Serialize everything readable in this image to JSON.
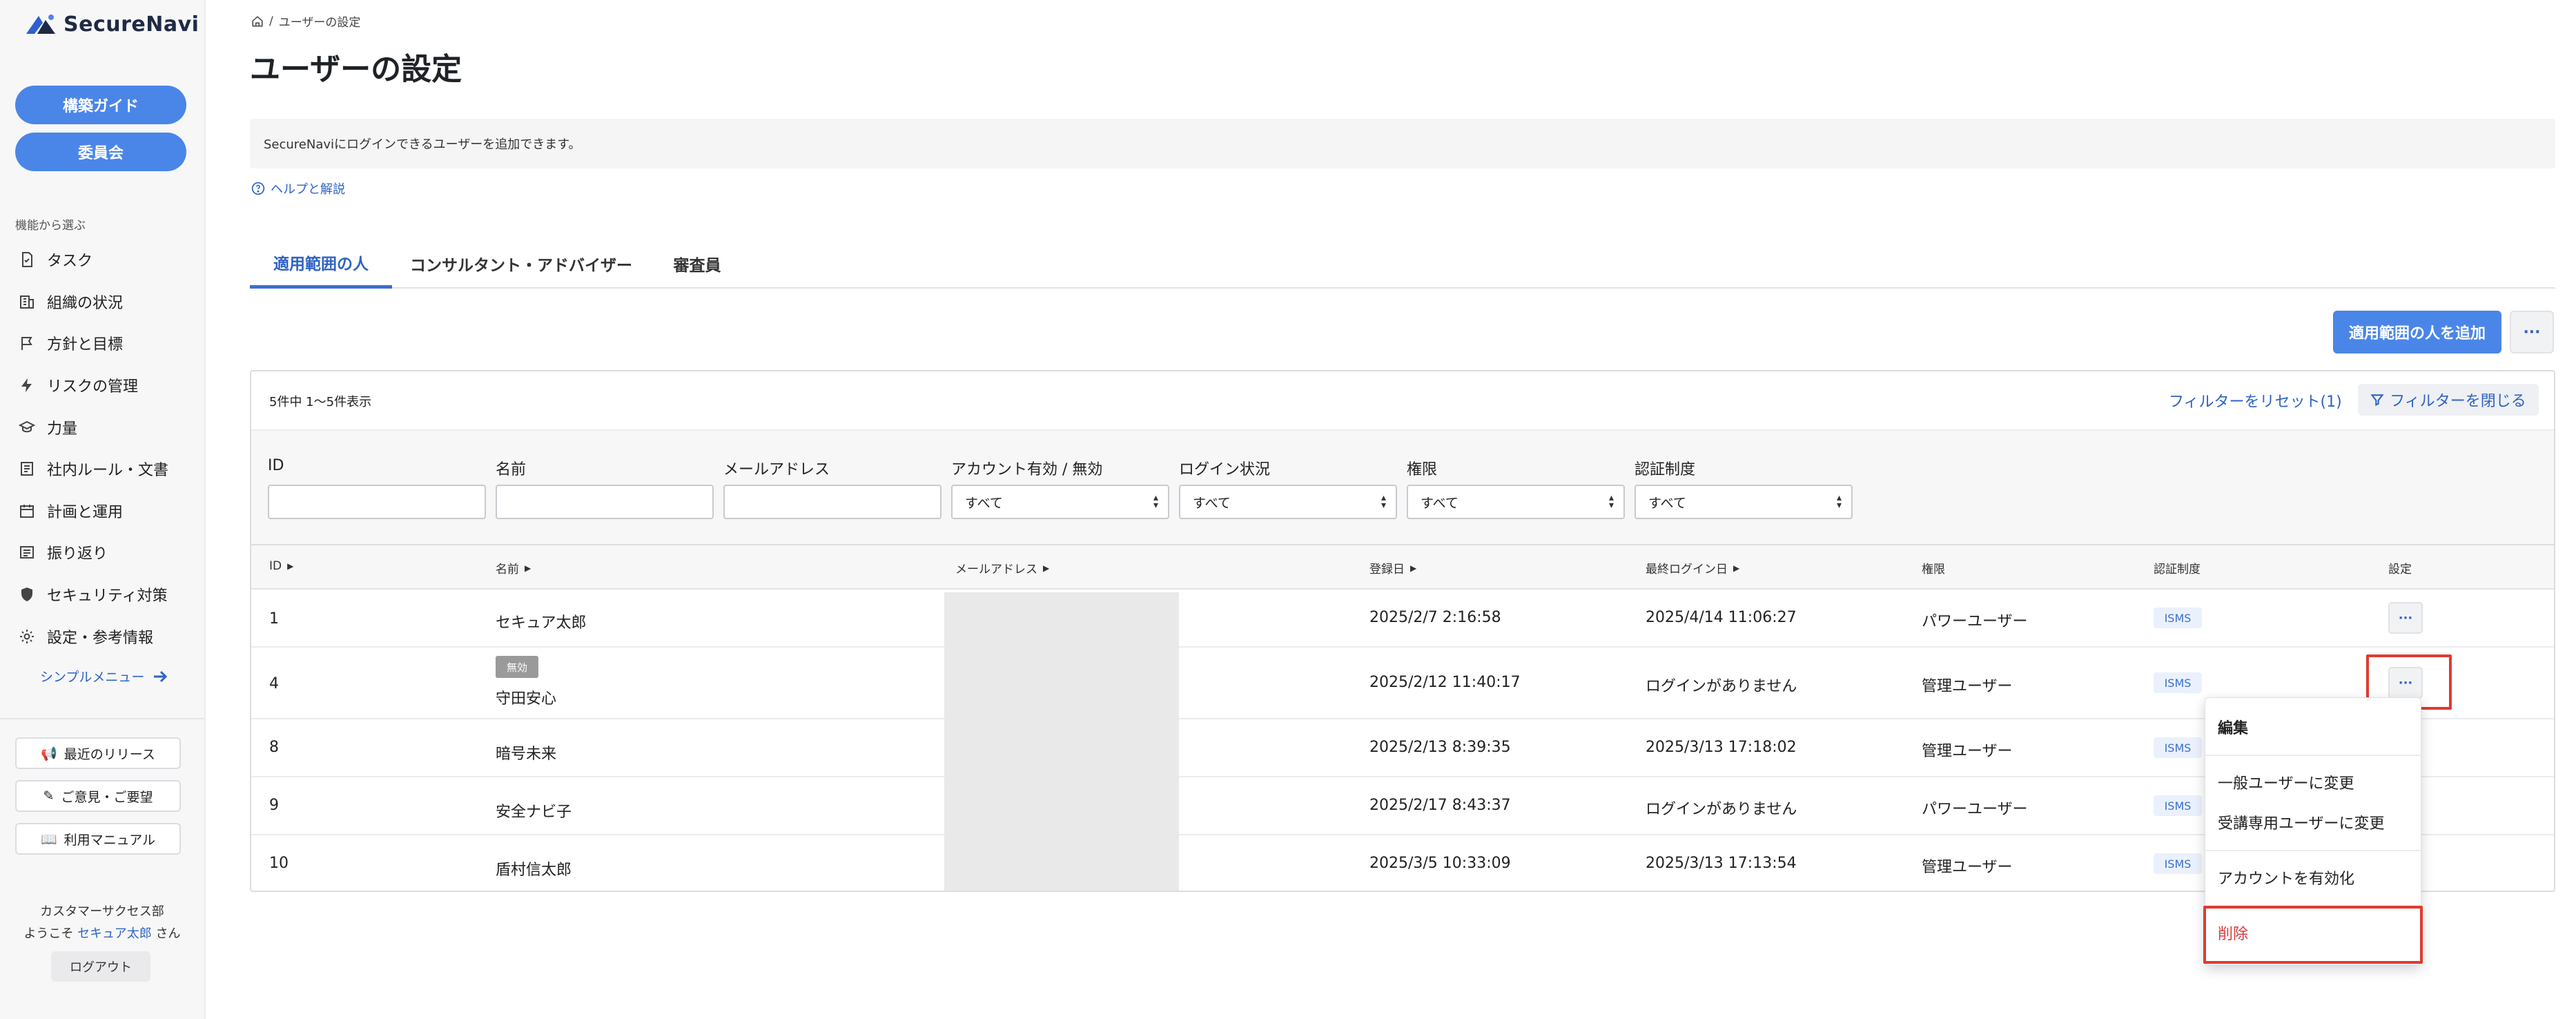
{
  "app": {
    "name": "SecureNavi"
  },
  "sidebar": {
    "guide_button": "構築ガイド",
    "committee_button": "委員会",
    "section_caption": "機能から選ぶ",
    "items": [
      {
        "label": "タスク",
        "icon": "task-icon"
      },
      {
        "label": "組織の状況",
        "icon": "building-icon"
      },
      {
        "label": "方針と目標",
        "icon": "flag-icon"
      },
      {
        "label": "リスクの管理",
        "icon": "bolt-icon"
      },
      {
        "label": "力量",
        "icon": "graduation-cap-icon"
      },
      {
        "label": "社内ルール・文書",
        "icon": "document-icon"
      },
      {
        "label": "計画と運用",
        "icon": "calendar-icon"
      },
      {
        "label": "振り返り",
        "icon": "review-icon"
      },
      {
        "label": "セキュリティ対策",
        "icon": "shield-icon"
      },
      {
        "label": "設定・参考情報",
        "icon": "gear-icon"
      }
    ],
    "simple_menu": "シンプルメニュー",
    "recent_releases": "最近のリリース",
    "feedback": "ご意見・ご要望",
    "manual": "利用マニュアル",
    "department": "カスタマーサクセス部",
    "welcome_prefix": "ようこそ",
    "user_name": "セキュア太郎",
    "welcome_suffix": "さん",
    "logout": "ログアウト"
  },
  "breadcrumb": {
    "current": "ユーザーの設定"
  },
  "page": {
    "title": "ユーザーの設定",
    "notice": "SecureNaviにログインできるユーザーを追加できます。",
    "help_link": "ヘルプと解説"
  },
  "tabs": [
    {
      "label": "適用範囲の人",
      "active": true
    },
    {
      "label": "コンサルタント・アドバイザー",
      "active": false
    },
    {
      "label": "審査員",
      "active": false
    }
  ],
  "toolbar": {
    "add_button": "適用範囲の人を追加",
    "more_button": "···"
  },
  "table": {
    "count_text": "5件中 1〜5件表示",
    "reset_filters": "フィルターをリセット(1)",
    "close_filters": "フィルターを閉じる",
    "filters": [
      {
        "label": "ID",
        "value": ""
      },
      {
        "label": "名前",
        "value": ""
      },
      {
        "label": "メールアドレス",
        "value": ""
      },
      {
        "label": "アカウント有効 / 無効",
        "value": "すべて"
      },
      {
        "label": "ログイン状況",
        "value": "すべて"
      },
      {
        "label": "権限",
        "value": "すべて"
      },
      {
        "label": "認証制度",
        "value": "すべて"
      }
    ],
    "columns": {
      "id": "ID",
      "name": "名前",
      "email": "メールアドレス",
      "registered": "登録日",
      "last_login": "最終ログイン日",
      "role": "権限",
      "certification": "認証制度",
      "settings": "設定"
    },
    "rows": [
      {
        "id": "1",
        "name": "セキュア太郎",
        "status_badge": "",
        "registered": "2025/2/7 2:16:58",
        "last_login": "2025/4/14 11:06:27",
        "role": "パワーユーザー",
        "certification": "ISMS"
      },
      {
        "id": "4",
        "name": "守田安心",
        "status_badge": "無効",
        "registered": "2025/2/12 11:40:17",
        "last_login": "ログインがありません",
        "role": "管理ユーザー",
        "certification": "ISMS"
      },
      {
        "id": "8",
        "name": "暗号未来",
        "status_badge": "",
        "registered": "2025/2/13 8:39:35",
        "last_login": "2025/3/13 17:18:02",
        "role": "管理ユーザー",
        "certification": "ISMS"
      },
      {
        "id": "9",
        "name": "安全ナビ子",
        "status_badge": "",
        "registered": "2025/2/17 8:43:37",
        "last_login": "ログインがありません",
        "role": "パワーユーザー",
        "certification": "ISMS"
      },
      {
        "id": "10",
        "name": "盾村信太郎",
        "status_badge": "",
        "registered": "2025/3/5 10:33:09",
        "last_login": "2025/3/13 17:13:54",
        "role": "管理ユーザー",
        "certification": "ISMS"
      }
    ],
    "row_menu_label": "···"
  },
  "row_menu": {
    "edit": "編集",
    "to_general": "一般ユーザーに変更",
    "to_trainee": "受講専用ユーザーに変更",
    "enable_account": "アカウントを有効化",
    "delete": "削除"
  },
  "colors": {
    "accent": "#4a86e8",
    "link": "#2f63c4",
    "highlight": "#e03a2f",
    "danger": "#d93a3a"
  }
}
